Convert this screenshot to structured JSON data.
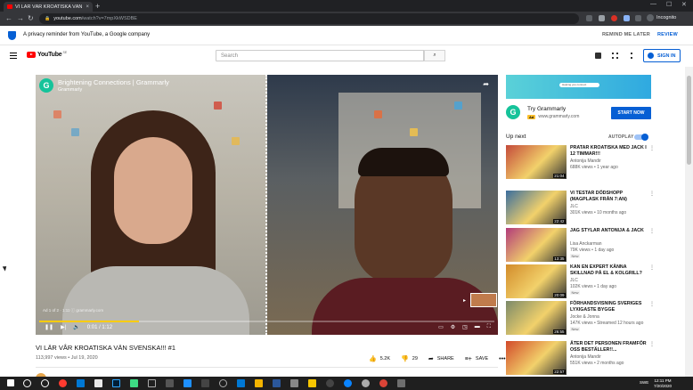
{
  "browser": {
    "tab_title": "VI LÄR VÅR KROATISKA VÄN",
    "tab_close": "×",
    "new_tab": "+",
    "url_host": "youtube.com",
    "url_rest": "/watch?v=7mpXkWSDBE",
    "profile_label": "Incognito",
    "window_min": "—",
    "window_max": "☐",
    "window_close": "✕"
  },
  "privacy": {
    "text": "A privacy reminder from YouTube, a Google company",
    "remind_later": "REMIND ME LATER",
    "review": "REVIEW"
  },
  "header": {
    "logo_text": "YouTube",
    "logo_country": "SE",
    "search_placeholder": "Search",
    "sign_in": "SIGN IN"
  },
  "player": {
    "channel_title": "Brightening Connections | Grammarly",
    "channel_name": "Grammarly",
    "ad_info": "Ad 1 of 2 · 1:11 ⓘ  grammarly.com",
    "time": "0:01 / 1:12",
    "progress_fraction": 0.22
  },
  "video": {
    "title": "VI LÄR VÅR KROATISKA VÄN SVENSKA!!! #1",
    "meta": "113,997 views • Jul 19, 2020",
    "likes": "5.2K",
    "dislikes": "29",
    "share": "SHARE",
    "save": "SAVE"
  },
  "sidebar": {
    "ad_pill": "Helping you connect",
    "ad_name": "Try Grammarly",
    "ad_badge": "Ad",
    "ad_domain": "www.grammarly.com",
    "ad_cta": "START NOW",
    "up_next": "Up next",
    "autoplay": "AUTOPLAY",
    "videos": [
      {
        "title": "PRATAR KROATISKA MED JACK I 12 TIMMAR!!!",
        "channel": "Antonija Mandir",
        "views": "688K views • 1 year ago",
        "duration": "21:04",
        "badge": "",
        "color": "#c44a3a"
      },
      {
        "title": "VI TESTAR DÖDSHOPP (MAGPLASK FRÅN 7:AN)",
        "channel": "JLC",
        "views": "301K views • 10 months ago",
        "duration": "22:42",
        "badge": "",
        "color": "#3a6e9e"
      },
      {
        "title": "JAG STYLAR ANTONIJA & JACK",
        "channel": "Lisa Anckarman",
        "views": "79K views • 1 day ago",
        "duration": "13:35",
        "badge": "New",
        "color": "#b23a7a"
      },
      {
        "title": "KAN EN EXPERT KÄNNA SKILLNAD PÅ EL & KOLGRILL?",
        "channel": "JLC",
        "views": "102K views • 1 day ago",
        "duration": "20:09",
        "badge": "New",
        "color": "#d28b2a"
      },
      {
        "title": "FÖRHANDSVISNING SVERIGES LYXIGASTE BYGGE",
        "channel": "Jocke & Jonna",
        "views": "147K views • Streamed 12 hours ago",
        "duration": "26:55",
        "badge": "New",
        "color": "#7b8a6a"
      },
      {
        "title": "ÄTER DET PERSONEN FRAMFÖR OSS BESTÄLLER!!...",
        "channel": "Antonija Mandir",
        "views": "551K views • 2 months ago",
        "duration": "22:57",
        "badge": "",
        "color": "#d24a2a"
      }
    ]
  },
  "taskbar": {
    "lang": "SWE",
    "time": "12:11 PM",
    "date": "7/20/2020"
  }
}
